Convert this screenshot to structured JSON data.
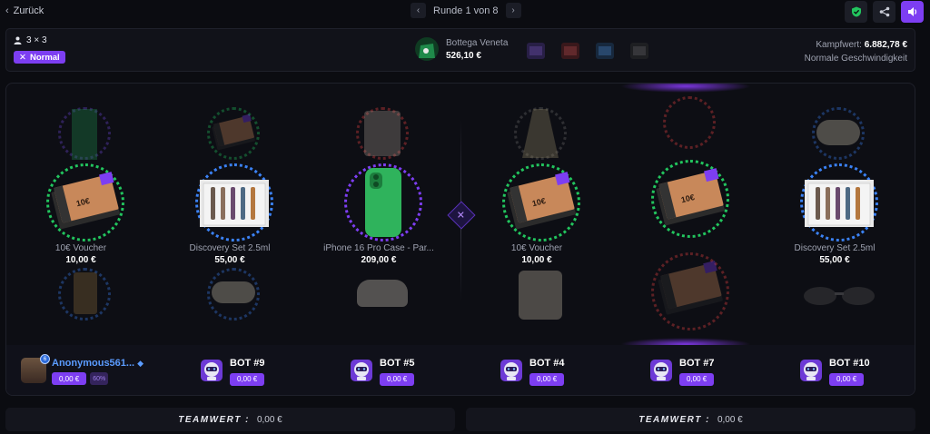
{
  "topbar": {
    "back_label": "Zurück",
    "round_label": "Runde 1 von 8",
    "icons": [
      "shield-check-icon",
      "share-icon",
      "volume-icon"
    ]
  },
  "info": {
    "mode": "3 × 3",
    "speed_badge": "Normal",
    "current_item": {
      "name": "Bottega Veneta",
      "price": "526,10 €"
    },
    "kampfwert_label": "Kampfwert:",
    "kampfwert_value": "6.882,78 €",
    "speed_text": "Normale Geschwindigkeit"
  },
  "slots": [
    {
      "name": "10€ Voucher",
      "price": "10,00 €"
    },
    {
      "name": "Discovery Set 2.5ml",
      "price": "55,00 €"
    },
    {
      "name": "iPhone 16 Pro Case - Par...",
      "price": "209,00 €"
    },
    {
      "name": "10€ Voucher",
      "price": "10,00 €"
    },
    {
      "name": "",
      "price": ""
    },
    {
      "name": "Discovery Set 2.5ml",
      "price": "55,00 €"
    }
  ],
  "voucher_text": "10€",
  "players": [
    {
      "name": "Anonymous561...",
      "value": "0,00 €",
      "percent": "60%",
      "level": "6"
    },
    {
      "name": "BOT #9",
      "value": "0,00 €",
      "level": "★"
    },
    {
      "name": "BOT #5",
      "value": "0,00 €",
      "level": "★"
    },
    {
      "name": "BOT #4",
      "value": "0,00 €",
      "level": "★"
    },
    {
      "name": "BOT #7",
      "value": "0,00 €",
      "level": "★"
    },
    {
      "name": "BOT #10",
      "value": "0,00 €",
      "level": "★"
    }
  ],
  "teams": [
    {
      "label": "TEAMWERT :",
      "value": "0,00 €"
    },
    {
      "label": "TEAMWERT :",
      "value": "0,00 €"
    }
  ],
  "colors": {
    "accent": "#7d3ef2",
    "green": "#22c55e",
    "blue": "#3b82f6",
    "red": "#ef4444",
    "username": "#5b9cff"
  }
}
